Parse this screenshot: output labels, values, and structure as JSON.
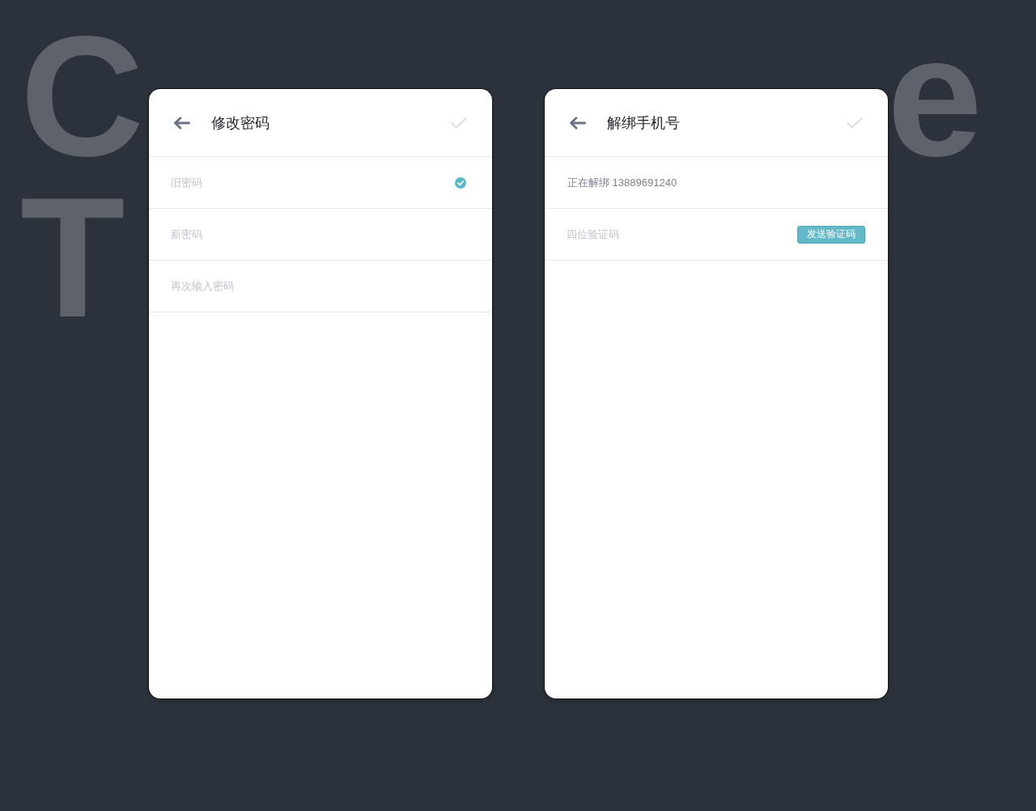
{
  "background_title": {
    "lines": [
      {
        "start": "C",
        "end": "e"
      },
      {
        "start": "T"
      }
    ]
  },
  "panels": [
    {
      "title": "修改密码",
      "confirm": {
        "disabled": true
      },
      "rows": [
        {
          "kind": "field",
          "placeholder": "旧密码",
          "valid": true
        },
        {
          "kind": "field",
          "placeholder": "新密码",
          "valid": false
        },
        {
          "kind": "field",
          "placeholder": "再次输入密码",
          "valid": false
        }
      ]
    },
    {
      "title": "解绑手机号",
      "confirm": {
        "disabled": true
      },
      "rows": [
        {
          "kind": "info",
          "text": "正在解绑 13889691240"
        },
        {
          "kind": "field",
          "placeholder": "四位验证码",
          "valid": false,
          "action": "发送验证码"
        }
      ]
    }
  ]
}
